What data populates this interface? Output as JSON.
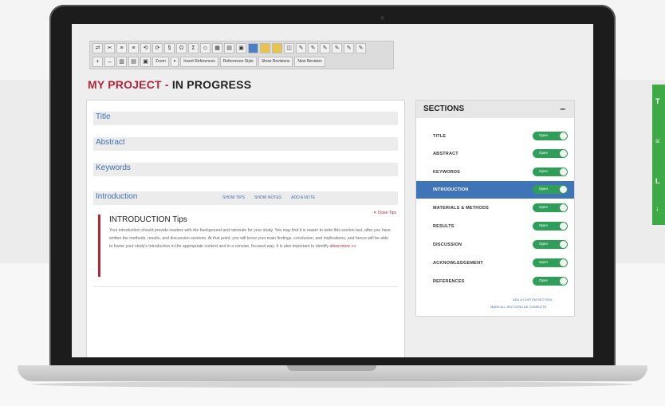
{
  "toolbar": {
    "row1_icons": [
      "⇄",
      "✂",
      "≡",
      "≡",
      "⟲",
      "⟳",
      "§",
      "Ω",
      "Σ",
      "◇",
      "▦",
      "▤",
      "▣",
      "■",
      "■",
      "◫",
      "✎",
      "✎",
      "✎",
      "✎",
      "✎",
      "✎"
    ],
    "row2_icons": [
      "+",
      "↔",
      "▥",
      "▤",
      "▣"
    ],
    "zoom_label": "Zoom",
    "insert_references_label": "Insert References",
    "references_style_label": "References Style",
    "show_revisions_label": "Show Revisions",
    "new_revision_label": "New Revision"
  },
  "project": {
    "title_part1": "MY PROJECT",
    "title_sep": " - ",
    "title_part2": "IN PROGRESS"
  },
  "editor": {
    "fields": [
      "Title",
      "Abstract",
      "Keywords"
    ],
    "intro_label": "Introduction",
    "show_tips": "SHOW TIPS",
    "show_notes": "SHOW NOTES",
    "add_note": "ADD A NOTE",
    "close_tips": "✕ Close Tips",
    "tips_title": "INTRODUCTION Tips",
    "tips_body": "Your introduction should provide readers with the background and rationale for your study. You may find it is easier to write this section last, after you have written the methods, results, and discussion sections. At that point, you will know your main findings, conclusion, and implications, and hence will be able to frame your study's introduction in the appropriate context and in a concise, focused way. It is also important to identify",
    "show_more": "show more >>"
  },
  "sections": {
    "title": "SECTIONS",
    "collapse": "–",
    "toggle_text": "Open",
    "items": [
      {
        "label": "TITLE",
        "active": false
      },
      {
        "label": "ABSTRACT",
        "active": false
      },
      {
        "label": "KEYWORDS",
        "active": false
      },
      {
        "label": "INTRODUCTION",
        "active": true
      },
      {
        "label": "MATERIALS & METHODS",
        "active": false
      },
      {
        "label": "RESULTS",
        "active": false
      },
      {
        "label": "DISCUSSION",
        "active": false
      },
      {
        "label": "ACKNOWLEDGEMENT",
        "active": false
      },
      {
        "label": "REFERENCES",
        "active": false
      }
    ],
    "add_custom": "ADD A CUSTOM SECTION",
    "mark_complete": "MARK ALL SECTIONS AS COMPLETE"
  },
  "colors": {
    "accent_red": "#b3263a",
    "link_blue": "#3e6fb0",
    "active_blue": "#3f74b8",
    "toggle_green": "#2f9e58",
    "side_tab_green": "#3daa45"
  },
  "side_tab": {
    "glyphs": [
      "T",
      "=",
      "L",
      "↓"
    ]
  }
}
